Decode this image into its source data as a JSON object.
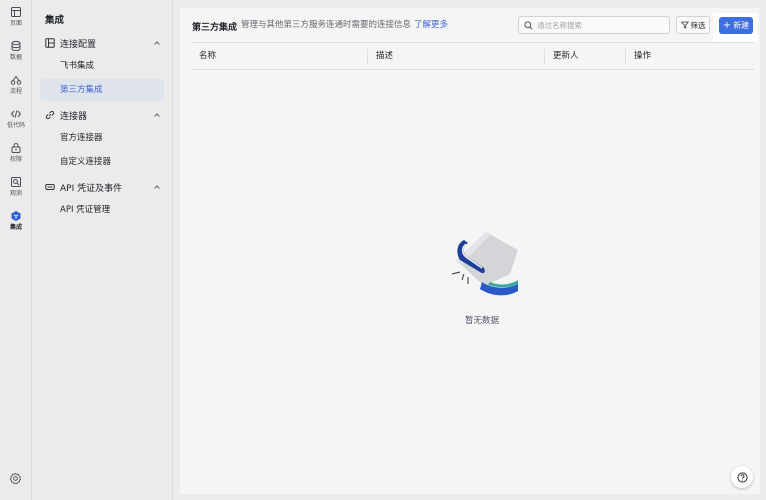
{
  "rail": {
    "items": [
      {
        "label": "页面",
        "icon": "page-icon"
      },
      {
        "label": "数据",
        "icon": "database-icon"
      },
      {
        "label": "流程",
        "icon": "flow-icon"
      },
      {
        "label": "低代码",
        "icon": "code-icon"
      },
      {
        "label": "权限",
        "icon": "lock-icon"
      },
      {
        "label": "观测",
        "icon": "monitor-icon"
      },
      {
        "label": "集成",
        "icon": "integration-icon",
        "active": true
      }
    ],
    "bottom_icon": "settings-icon"
  },
  "nav": {
    "title": "集成",
    "groups": [
      {
        "label": "连接配置",
        "icon": "config-icon",
        "items": [
          "飞书集成",
          "第三方集成"
        ]
      },
      {
        "label": "连接器",
        "icon": "link-icon",
        "items": [
          "官方连接器",
          "自定义连接器"
        ]
      },
      {
        "label": "API 凭证及事件",
        "icon": "api-icon",
        "items": [
          "API 凭证管理"
        ]
      }
    ],
    "active_item": "第三方集成"
  },
  "header": {
    "title": "第三方集成",
    "description": "管理与其他第三方服务连通时需要的连接信息",
    "learn_more": "了解更多"
  },
  "search": {
    "placeholder": "通过名称搜索",
    "value": ""
  },
  "filter_label": "筛选",
  "new_label": "新建",
  "table": {
    "columns": [
      "名称",
      "描述",
      "更新人",
      "操作"
    ]
  },
  "empty_text": "暂无数据",
  "colors": {
    "accent": "#3c6fe0",
    "link": "#3b63d3"
  }
}
